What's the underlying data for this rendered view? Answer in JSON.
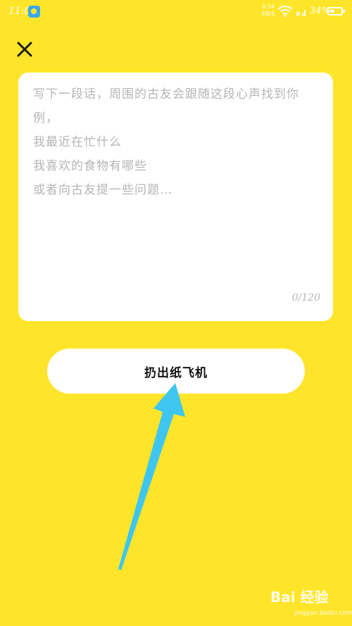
{
  "status_bar": {
    "time": "11:07",
    "net_speed_value": "0.34",
    "net_speed_unit": "KB/S",
    "battery_percent": "34%",
    "icons": [
      "app-notification-icon",
      "wifi-icon",
      "signal-icon",
      "battery-icon"
    ]
  },
  "header": {
    "close_icon": "close-icon"
  },
  "composer": {
    "placeholder": "写下一段话，周围的古友会跟随这段心声找到你\n例，\n我最近在忙什么\n我喜欢的食物有哪些\n或者向古友提一些问题…",
    "counter": "0/120"
  },
  "actions": {
    "throw_label": "扔出纸飞机"
  },
  "watermark": {
    "brand": "Bai 经验",
    "url": "jingyan.baidu.com"
  },
  "colors": {
    "background": "#ffe529",
    "card": "#ffffff",
    "placeholder_text": "#b5b5b5",
    "annotation_arrow": "#3ec6f0"
  }
}
